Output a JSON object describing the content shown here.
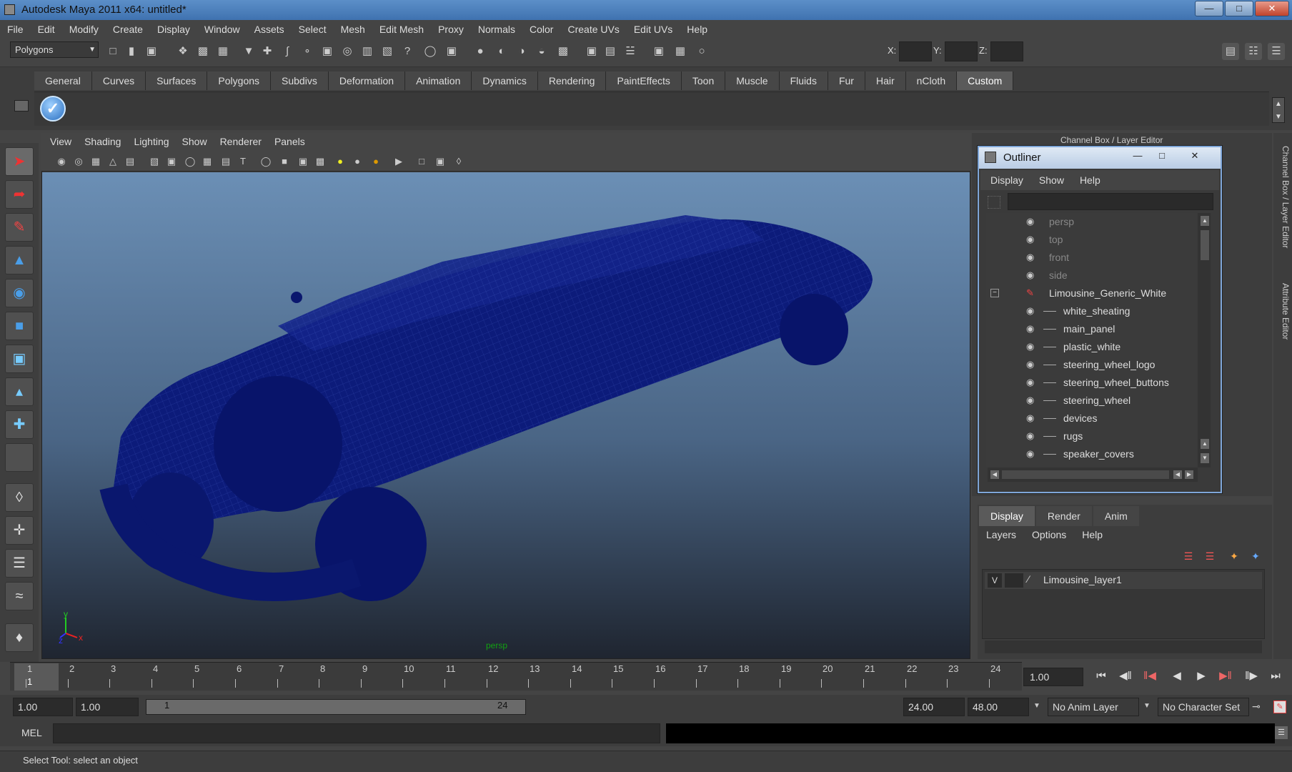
{
  "window": {
    "title": "Autodesk Maya 2011 x64: untitled*"
  },
  "menubar": [
    "File",
    "Edit",
    "Modify",
    "Create",
    "Display",
    "Window",
    "Assets",
    "Select",
    "Mesh",
    "Edit Mesh",
    "Proxy",
    "Normals",
    "Color",
    "Create UVs",
    "Edit UVs",
    "Help"
  ],
  "toolbar": {
    "menuset": "Polygons",
    "x_label": "X:",
    "y_label": "Y:",
    "z_label": "Z:"
  },
  "shelf": {
    "tabs": [
      "General",
      "Curves",
      "Surfaces",
      "Polygons",
      "Subdivs",
      "Deformation",
      "Animation",
      "Dynamics",
      "Rendering",
      "PaintEffects",
      "Toon",
      "Muscle",
      "Fluids",
      "Fur",
      "Hair",
      "nCloth",
      "Custom"
    ],
    "active": "Custom"
  },
  "viewport": {
    "menu": [
      "View",
      "Shading",
      "Lighting",
      "Show",
      "Renderer",
      "Panels"
    ],
    "camera_label": "persp",
    "wire_color": "#0a1a78"
  },
  "channelbox": {
    "title": "Channel Box / Layer Editor",
    "side_tabs": [
      "Channel Box / Layer Editor",
      "Attribute Editor"
    ]
  },
  "outliner": {
    "title": "Outliner",
    "menu": [
      "Display",
      "Show",
      "Help"
    ],
    "items": [
      {
        "label": "persp",
        "depth": 0,
        "dim": true
      },
      {
        "label": "top",
        "depth": 0,
        "dim": true
      },
      {
        "label": "front",
        "depth": 0,
        "dim": true
      },
      {
        "label": "side",
        "depth": 0,
        "dim": true
      },
      {
        "label": "Limousine_Generic_White",
        "depth": 0,
        "dim": false
      },
      {
        "label": "white_sheating",
        "depth": 1,
        "dim": false
      },
      {
        "label": "main_panel",
        "depth": 1,
        "dim": false
      },
      {
        "label": "plastic_white",
        "depth": 1,
        "dim": false
      },
      {
        "label": "steering_wheel_logo",
        "depth": 1,
        "dim": false
      },
      {
        "label": "steering_wheel_buttons",
        "depth": 1,
        "dim": false
      },
      {
        "label": "steering_wheel",
        "depth": 1,
        "dim": false
      },
      {
        "label": "devices",
        "depth": 1,
        "dim": false
      },
      {
        "label": "rugs",
        "depth": 1,
        "dim": false
      },
      {
        "label": "speaker_covers",
        "depth": 1,
        "dim": false
      }
    ]
  },
  "layers": {
    "tabs": [
      "Display",
      "Render",
      "Anim"
    ],
    "active": "Display",
    "menu": [
      "Layers",
      "Options",
      "Help"
    ],
    "visible_flag": "V",
    "items": [
      "Limousine_layer1"
    ]
  },
  "timeline": {
    "ticks": [
      "1",
      "2",
      "3",
      "4",
      "5",
      "6",
      "7",
      "8",
      "9",
      "10",
      "11",
      "12",
      "13",
      "14",
      "15",
      "16",
      "17",
      "18",
      "19",
      "20",
      "21",
      "22",
      "23",
      "24"
    ],
    "current_marker": "1",
    "current_frame": "1.00"
  },
  "range": {
    "start": "1.00",
    "playback_start": "1.00",
    "slider_start": "1",
    "slider_end": "24",
    "playback_end": "24.00",
    "end": "48.00",
    "anim_layer": "No Anim Layer",
    "character_set": "No Character Set"
  },
  "mel": {
    "label": "MEL"
  },
  "status": {
    "text": "Select Tool: select an object"
  }
}
